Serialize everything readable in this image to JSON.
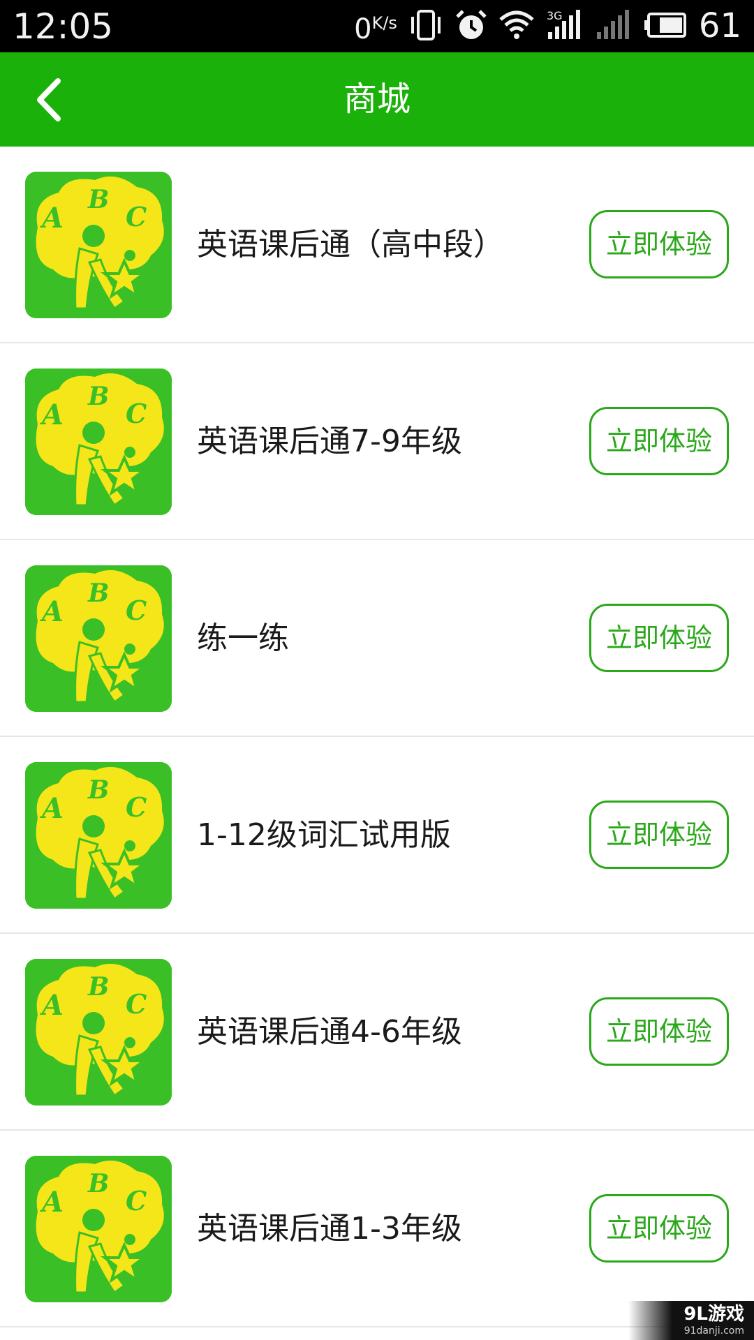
{
  "status_bar": {
    "time": "12:05",
    "net_speed_value": "0",
    "net_speed_unit": "K/s",
    "network_type": "3G",
    "battery_percent": "61",
    "icons": [
      "vibrate-icon",
      "alarm-icon",
      "wifi-icon",
      "signal-3g-icon",
      "signal-icon",
      "battery-icon"
    ]
  },
  "header": {
    "title": "商城",
    "back_icon": "chevron-left-icon",
    "background_color": "#1bb10b"
  },
  "products": [
    {
      "name": "英语课后通（高中段）",
      "button_label": "立即体验",
      "icon": "abc-tree-logo"
    },
    {
      "name": "英语课后通7-9年级",
      "button_label": "立即体验",
      "icon": "abc-tree-logo"
    },
    {
      "name": "练一练",
      "button_label": "立即体验",
      "icon": "abc-tree-logo"
    },
    {
      "name": "1-12级词汇试用版",
      "button_label": "立即体验",
      "icon": "abc-tree-logo"
    },
    {
      "name": "英语课后通4-6年级",
      "button_label": "立即体验",
      "icon": "abc-tree-logo"
    },
    {
      "name": "英语课后通1-3年级",
      "button_label": "立即体验",
      "icon": "abc-tree-logo"
    }
  ],
  "logo_letters": {
    "a": "A",
    "b": "B",
    "c": "C"
  },
  "watermark": {
    "logo": "9L游戏",
    "url": "91danji.com"
  },
  "colors": {
    "accent": "#1bb10b",
    "button_border": "#2aa81a",
    "icon_background": "#3bbf27",
    "icon_foreground": "#f5e61a"
  }
}
